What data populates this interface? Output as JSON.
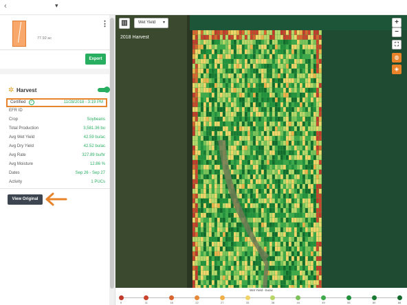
{
  "topbar": {
    "back_glyph": "‹",
    "caret_glyph": "▾"
  },
  "field": {
    "acreage": "77.92 ac",
    "menu_glyph": "⋮"
  },
  "export_label": "Export",
  "harvest": {
    "title": "Harvest",
    "icon": "wheat-icon",
    "enabled": true,
    "certified_label": "Certified",
    "certified_date": "11/28/2018 - 3:19 PM"
  },
  "details": [
    {
      "key": "EFR ID",
      "value": ""
    },
    {
      "key": "Crop",
      "value": "Soybeans"
    },
    {
      "key": "Total Production",
      "value": "3,581.36 bu"
    },
    {
      "key": "Avg Wet Yield",
      "value": "42.59 bu/ac"
    },
    {
      "key": "Avg Dry Yield",
      "value": "42.52 bu/ac"
    },
    {
      "key": "Avg Rate",
      "value": "327.89 bu/hr"
    },
    {
      "key": "Avg Moisture",
      "value": "12.86 %"
    },
    {
      "key": "Dates",
      "value": "Sep 26 - Sep 27"
    },
    {
      "key": "Activity",
      "value": "1 PUCs"
    }
  ],
  "view_original_label": "View Original",
  "map": {
    "layer_select": "Wet Yield",
    "harvest_label": "2018 Harvest",
    "zoom_in": "+",
    "zoom_out": "−",
    "fullscreen": "⛶",
    "globe": "◍",
    "layers": "◈",
    "panel_toggle": "▥"
  },
  "legend": {
    "title": "Wet Yield - bu/ac",
    "ticks": [
      "0",
      "11",
      "16",
      "22",
      "27",
      "33",
      "38",
      "44",
      "49",
      "55",
      "60",
      "66"
    ],
    "colors": [
      "#c0392b",
      "#c9442c",
      "#d9642f",
      "#e6883a",
      "#eeb04a",
      "#f0d46a",
      "#b9d66a",
      "#7cc25a",
      "#3fa84a",
      "#23903e",
      "#1a7a34",
      "#126a2c"
    ]
  },
  "accent": "#27ae60",
  "highlight": "#e8832a"
}
